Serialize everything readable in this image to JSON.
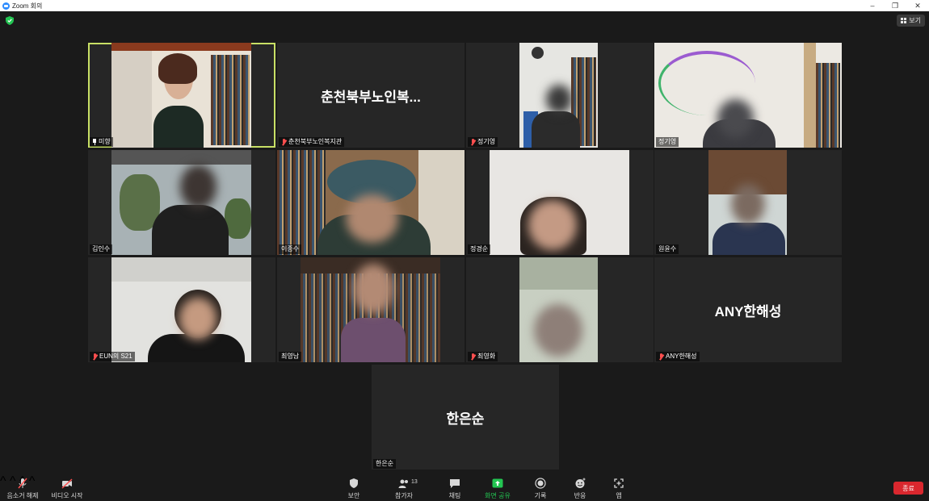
{
  "window": {
    "title": "Zoom 회의",
    "minimize": "–",
    "restore": "❐",
    "close": "✕"
  },
  "topbar": {
    "view_label": "보기"
  },
  "tiles": [
    {
      "name": "미향",
      "mode": "video"
    },
    {
      "name": "춘천북부노인복지관",
      "display": "춘천북부노인복...",
      "mode": "name",
      "muted": true
    },
    {
      "name": "정기영",
      "mode": "video",
      "muted": true
    },
    {
      "name": "정기영",
      "mode": "video"
    },
    {
      "name": "김인수",
      "mode": "video"
    },
    {
      "name": "이종수",
      "mode": "video"
    },
    {
      "name": "정경순",
      "mode": "video"
    },
    {
      "name": "원윤수",
      "mode": "video"
    },
    {
      "name": "EUN의 S21",
      "mode": "video",
      "muted": true
    },
    {
      "name": "최영남",
      "mode": "video"
    },
    {
      "name": "최영화",
      "mode": "video",
      "muted": true
    },
    {
      "name": "ANY한해성",
      "display": "ANY한해성",
      "mode": "name",
      "muted": true
    },
    {
      "name": "한은순",
      "display": "한은순",
      "mode": "name"
    }
  ],
  "toolbar": {
    "mute_label": "음소거 해제",
    "video_label": "비디오 시작",
    "security_label": "보안",
    "participants_label": "참가자",
    "participants_count": "13",
    "chat_label": "채팅",
    "share_label": "화면 공유",
    "record_label": "기록",
    "reactions_label": "반응",
    "apps_label": "앱",
    "end_label": "종료",
    "caret": "^"
  },
  "colors": {
    "share_green": "#23c552",
    "end_red": "#d9272e",
    "active_border": "#c8e065",
    "muted_red": "#ff4f4f"
  }
}
